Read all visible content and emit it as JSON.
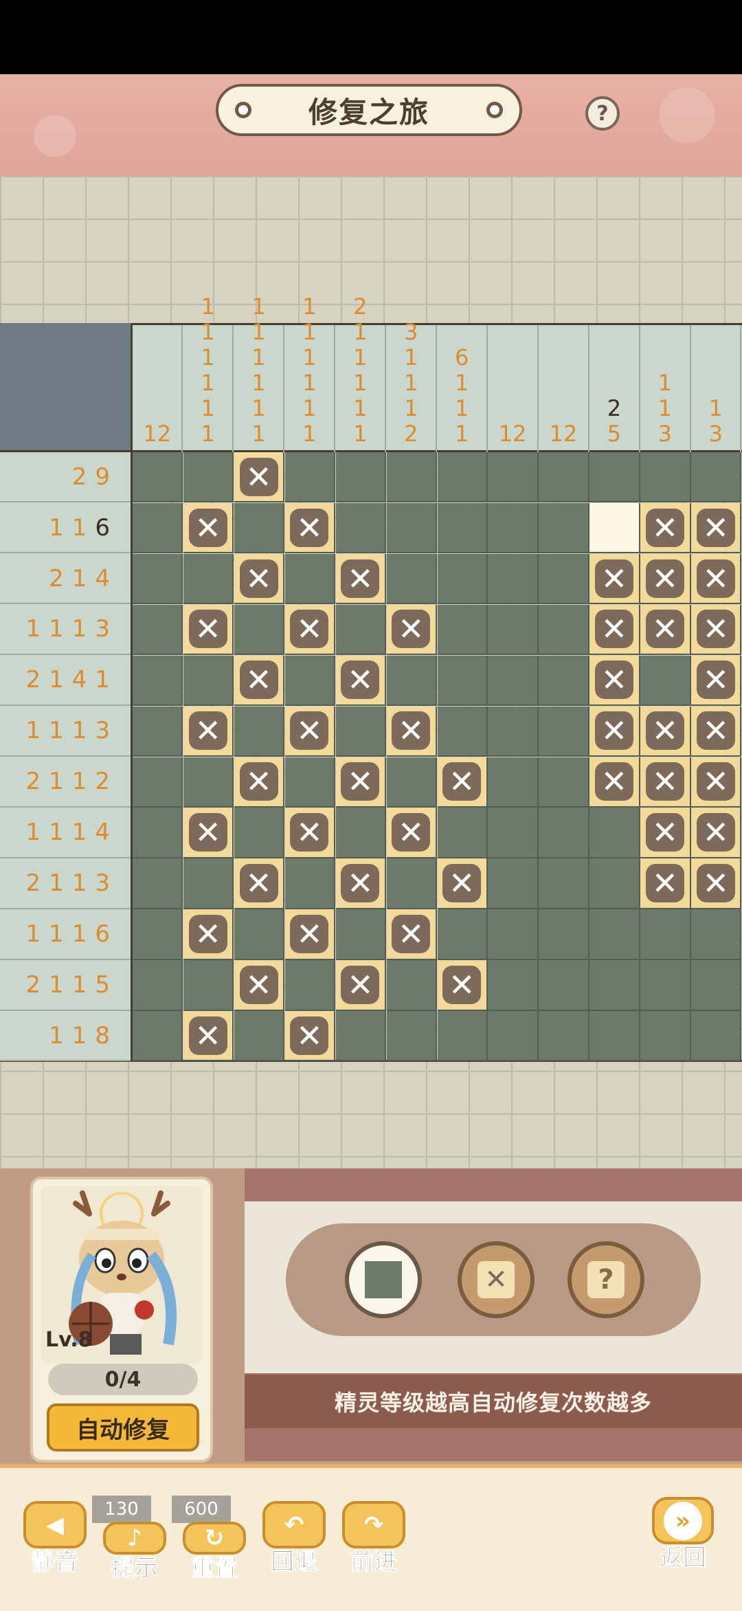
{
  "header": {
    "title": "修复之旅",
    "help_glyph": "?"
  },
  "puzzle": {
    "rows": 12,
    "cols": 12,
    "col_clues": [
      [
        "12"
      ],
      [
        "1",
        "1",
        "1",
        "1",
        "1",
        "1"
      ],
      [
        "1",
        "1",
        "1",
        "1",
        "1",
        "1"
      ],
      [
        "1",
        "1",
        "1",
        "1",
        "1",
        "1"
      ],
      [
        "2",
        "1",
        "1",
        "1",
        "1",
        "1"
      ],
      [
        "3",
        "1",
        "1",
        "1",
        "2"
      ],
      [
        "6",
        "1",
        "1",
        "1"
      ],
      [
        "12"
      ],
      [
        "12"
      ],
      [
        "2",
        "5"
      ],
      [
        "1",
        "1",
        "3"
      ],
      [
        "1",
        "3"
      ]
    ],
    "col_clue_done": [
      [
        false
      ],
      [
        false,
        false,
        false,
        false,
        false,
        false
      ],
      [
        false,
        false,
        false,
        false,
        false,
        false
      ],
      [
        false,
        false,
        false,
        false,
        false,
        false
      ],
      [
        false,
        false,
        false,
        false,
        false,
        false
      ],
      [
        false,
        false,
        false,
        false,
        false
      ],
      [
        false,
        false,
        false,
        false
      ],
      [
        false
      ],
      [
        false
      ],
      [
        true,
        false
      ],
      [
        false,
        false,
        false
      ],
      [
        false,
        false
      ]
    ],
    "row_clues": [
      "29",
      "116",
      "214",
      "1113",
      "2141",
      "1113",
      "2112",
      "1114",
      "2113",
      "1116",
      "2115",
      "118"
    ],
    "row_clue_done_last": [
      false,
      true,
      false,
      false,
      false,
      false,
      false,
      false,
      false,
      false,
      false,
      false
    ],
    "cells": [
      "..x.........",
      ".x.x.....bxx",
      "..x.x....xxx",
      ".x.x.x...xxx",
      "..x.x....x.x",
      ".x.x.x...xxx",
      "..x.x.x..xxx",
      ".x.x.x....xx",
      "..x.x.x...xx",
      ".x.x.x......",
      "..x.x.x.....",
      ".x.x........"
    ],
    "legend": {
      "x": "crossed",
      ".": "filled",
      "b": "empty"
    },
    "x_glyph": "✕"
  },
  "spirit": {
    "level": "Lv.8",
    "counter": "0/4",
    "auto_button": "自动修复"
  },
  "tools": {
    "fill": "fill-tool",
    "cross": "✕",
    "question": "?"
  },
  "tip": "精灵等级越高自动修复次数越多",
  "bottom": {
    "mute": "静音",
    "hint": "提示",
    "hint_cost": "130",
    "reset": "重置",
    "reset_cost": "600",
    "undo": "回退",
    "redo": "前进",
    "back": "返回"
  },
  "colors": {
    "filled": "#6c7a6c",
    "crossed": "#f3d99a",
    "clue": "#e08a2e",
    "clue_done": "#3a2a20"
  }
}
